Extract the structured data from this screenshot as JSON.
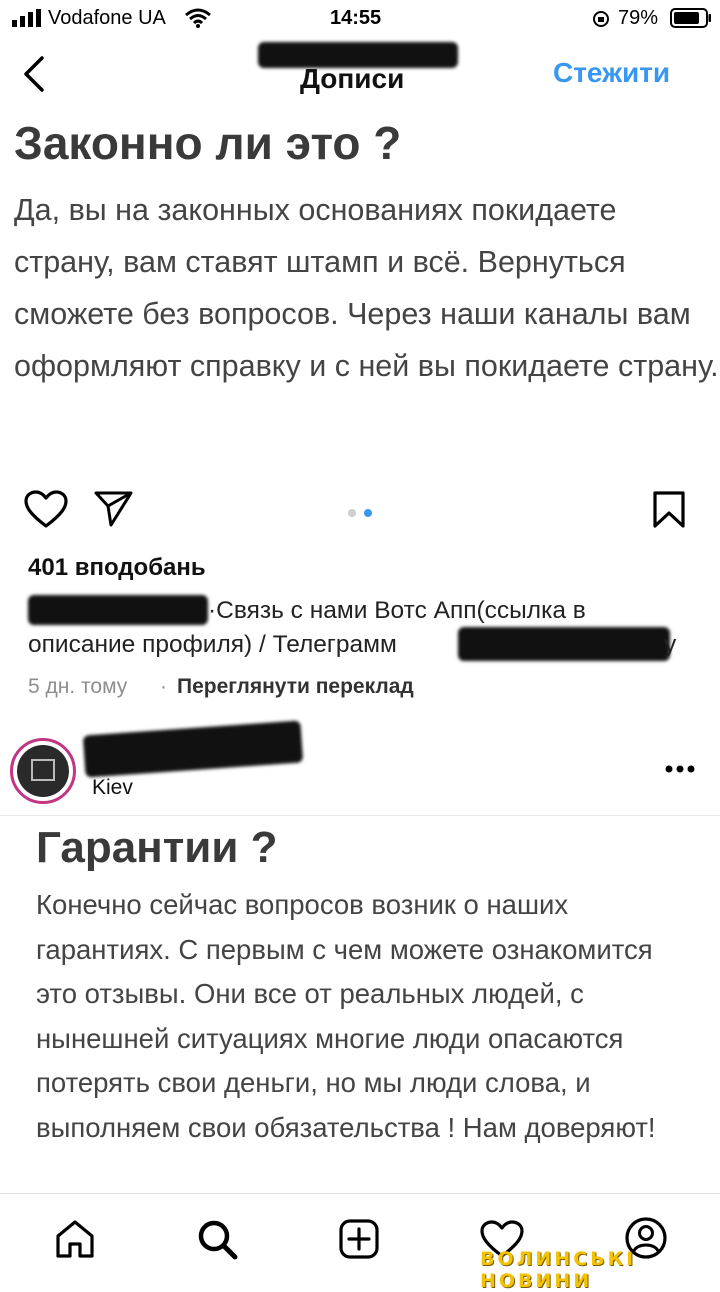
{
  "status_bar": {
    "carrier": "Vodafone UA",
    "time": "14:55",
    "battery": "79%",
    "icons": [
      "signal-icon",
      "wifi-icon",
      "orientation-lock-icon",
      "battery-icon"
    ]
  },
  "header": {
    "title": "Дописи",
    "follow_label": "Стежити",
    "back_icon": "chevron-left-icon"
  },
  "post1": {
    "image_title": "Законно ли это ?",
    "image_body": "Да, вы на законных основаниях покидаете страну, вам ставят штамп и всё. Вернуться сможете без вопросов. Через наши каналы вам оформляют справку и с ней вы покидаете страну.",
    "likes": "401 вподобань",
    "caption_line1": "·Связь с нами Вотс Апп(ссылка в",
    "caption_line2_prefix": "описание профиля) / Телеграмм",
    "caption_tail": "y",
    "time_ago": "5 дн. тому",
    "separator": "·",
    "translate_label": "Переглянути переклад",
    "carousel": {
      "count": 2,
      "active_index": 1
    }
  },
  "post2": {
    "location": "Kiev",
    "more_icon": "more-horizontal-icon",
    "image_title": "Гарантии ?",
    "image_body": "Конечно сейчас вопросов возник о наших гарантиях. С первым с чем можете ознакомится это отзывы. Они все от реальных людей, с нынешней ситуациях многие люди опасаются потерять свои деньги, но мы люди слова, и выполняем свои обязательства ! Нам доверяют!"
  },
  "bottom_nav": {
    "items": [
      "home-icon",
      "search-icon",
      "create-post-icon",
      "activity-heart-icon",
      "profile-icon"
    ]
  },
  "watermark": "ВОЛИНСЬКІ НОВИНИ",
  "colors": {
    "accent": "#3897f0",
    "text": "#111111",
    "muted": "#8e8e8e",
    "watermark": "#f2c300"
  }
}
